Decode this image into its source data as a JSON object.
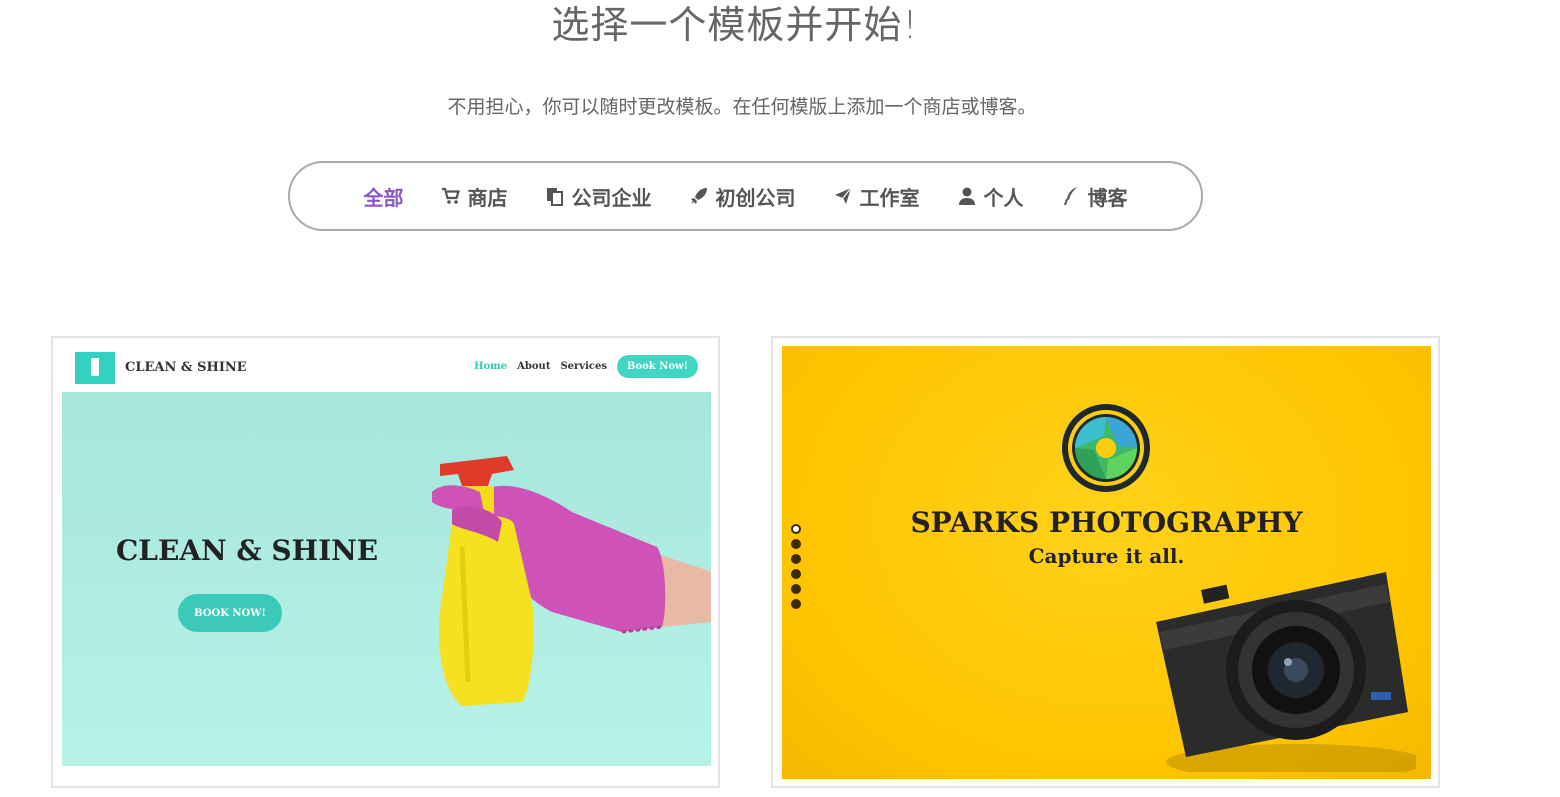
{
  "header": {
    "title": "选择一个模板并开始!",
    "subtitle": "不用担心，你可以随时更改模板。在任何模版上添加一个商店或博客。"
  },
  "filters": [
    {
      "label": "全部",
      "icon": "none",
      "active": true
    },
    {
      "label": "商店",
      "icon": "cart-icon",
      "active": false
    },
    {
      "label": "公司企业",
      "icon": "documents-icon",
      "active": false
    },
    {
      "label": "初创公司",
      "icon": "rocket-icon",
      "active": false
    },
    {
      "label": "工作室",
      "icon": "paper-plane-icon",
      "active": false
    },
    {
      "label": "个人",
      "icon": "user-icon",
      "active": false
    },
    {
      "label": "博客",
      "icon": "quill-icon",
      "active": false
    }
  ],
  "templates": [
    {
      "brand": "CLEAN & SHINE",
      "nav": {
        "home": "Home",
        "about": "About",
        "services": "Services",
        "book": "Book Now!"
      },
      "hero_title": "CLEAN & SHINE",
      "hero_button": "BOOK NOW!"
    },
    {
      "title": "SPARKS PHOTOGRAPHY",
      "tagline": "Capture it all."
    }
  ],
  "colors": {
    "accent": "#8a58c9",
    "teal": "#40d6c3",
    "yellow": "#ffc400"
  }
}
